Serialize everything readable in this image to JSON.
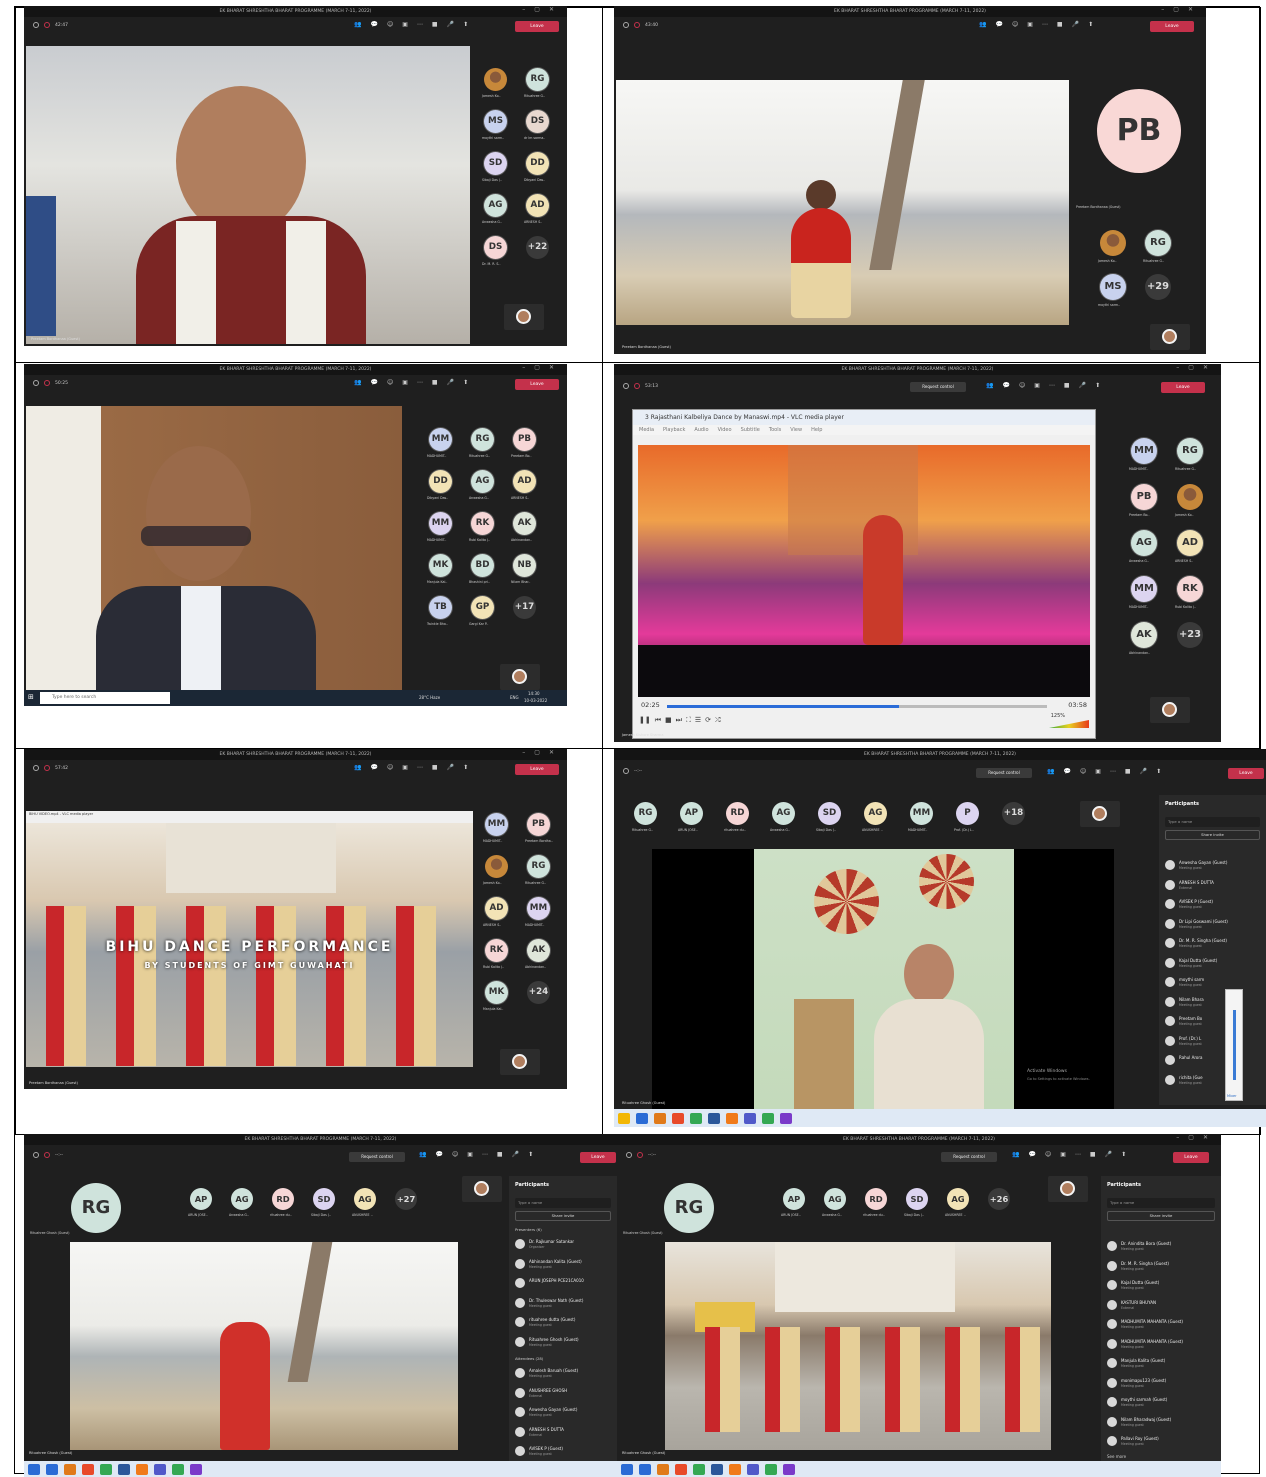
{
  "meeting_title": "EK BHARAT SHRESHTHA BHARAT PROGRAMME (MARCH 7-11, 2022)",
  "common": {
    "leave": "Leave",
    "request_control": "Request control",
    "participants": "Participants",
    "search_placeholder": "Type a name",
    "share_invite": "Share invite"
  },
  "p1": {
    "timer": "42:47",
    "guest": "Preetam Bordhanaa (Guest)",
    "more": "+22",
    "avatars": [
      {
        "initials": "",
        "name": "Jamesh Ko..",
        "color": "#c7883a"
      },
      {
        "initials": "RG",
        "name": "Rituahree G..",
        "color": "#cfe3dc"
      },
      {
        "initials": "MS",
        "name": "moythi sarm..",
        "color": "#c8d2ee"
      },
      {
        "initials": "DS",
        "name": "dr lm sarma..",
        "color": "#e8d8cf"
      },
      {
        "initials": "SD",
        "name": "Sibaji Das (..",
        "color": "#dcd4f0"
      },
      {
        "initials": "DD",
        "name": "Dibyani Das..",
        "color": "#f2e3b6"
      },
      {
        "initials": "AG",
        "name": "Anwesha G..",
        "color": "#cfe3dc"
      },
      {
        "initials": "AD",
        "name": "ARNESH S..",
        "color": "#f2e3b6"
      },
      {
        "initials": "DS",
        "name": "Dr. M. R. S..",
        "color": "#f6d6d6"
      }
    ]
  },
  "p2": {
    "timer": "43:40",
    "big_initials": "PB",
    "big_name": "Preetam Bordhanaa (Guest)",
    "guest": "Preetam Bordhanaa (Guest)",
    "more": "+29",
    "avatars": [
      {
        "initials": "",
        "name": "Jamesh Ko..",
        "color": "#c7883a"
      },
      {
        "initials": "RG",
        "name": "Rituahree G..",
        "color": "#cfe3dc"
      },
      {
        "initials": "MS",
        "name": "moythi sarm..",
        "color": "#c8d2ee"
      }
    ]
  },
  "p3": {
    "timer": "50:25",
    "more": "+17",
    "taskbar_search": "Type here to search",
    "weather": "28°C Haze",
    "clock_time": "14:30",
    "clock_date": "10-03-2022",
    "lang": "ENG",
    "avatars": [
      {
        "initials": "MM",
        "name": "MADHUMIT..",
        "color": "#c8d2ee"
      },
      {
        "initials": "RG",
        "name": "Rituahree G..",
        "color": "#cfe3dc"
      },
      {
        "initials": "PB",
        "name": "Preetam Bo..",
        "color": "#f6d6d6"
      },
      {
        "initials": "DD",
        "name": "Dibyani Das..",
        "color": "#f2e3b6"
      },
      {
        "initials": "AG",
        "name": "Anwesha G..",
        "color": "#cfe3dc"
      },
      {
        "initials": "AD",
        "name": "ARNESH S..",
        "color": "#f2e3b6"
      },
      {
        "initials": "MM",
        "name": "MADHUMIT..",
        "color": "#dcd4f0"
      },
      {
        "initials": "RK",
        "name": "Rubi Kalita (..",
        "color": "#f6d6d6"
      },
      {
        "initials": "AK",
        "name": "Abhinandan..",
        "color": "#dfe6da"
      },
      {
        "initials": "MK",
        "name": "Manjula Kal..",
        "color": "#cfe3dc"
      },
      {
        "initials": "BD",
        "name": "Bhashini pri..",
        "color": "#cfe3dc"
      },
      {
        "initials": "NB",
        "name": "Nilam Bhar..",
        "color": "#dfe6da"
      },
      {
        "initials": "TB",
        "name": "Twinkle Bha..",
        "color": "#c8d2ee"
      },
      {
        "initials": "GP",
        "name": "Gargi Kar P..",
        "color": "#f2e3b6"
      }
    ]
  },
  "p4": {
    "timer": "53:13",
    "more": "+23",
    "vlc_title": "3 Rajasthani Kalbeliya Dance by Manaswi.mp4 - VLC media player",
    "vlc_menu": [
      "Media",
      "Playback",
      "Audio",
      "Video",
      "Subtitle",
      "Tools",
      "View",
      "Help"
    ],
    "time_elapsed": "02:25",
    "time_total": "03:58",
    "volume": "125%",
    "progress": 0.61,
    "guest": "Jamesh Kishore Sharma",
    "avatars": [
      {
        "initials": "MM",
        "name": "MADHUMIT..",
        "color": "#c8d2ee"
      },
      {
        "initials": "RG",
        "name": "Rituahree G..",
        "color": "#cfe3dc"
      },
      {
        "initials": "PB",
        "name": "Preetam Bo..",
        "color": "#f6d6d6"
      },
      {
        "initials": "",
        "name": "Jamesh Ko..",
        "color": "#c7883a"
      },
      {
        "initials": "AG",
        "name": "Anwesha G..",
        "color": "#cfe3dc"
      },
      {
        "initials": "AD",
        "name": "ARNESH S..",
        "color": "#f2e3b6"
      },
      {
        "initials": "MM",
        "name": "MADHUMIT..",
        "color": "#dcd4f0"
      },
      {
        "initials": "RK",
        "name": "Rubi Kalita (..",
        "color": "#f6d6d6"
      },
      {
        "initials": "AK",
        "name": "Abhinandan..",
        "color": "#dfe6da"
      }
    ]
  },
  "p5": {
    "timer": "57:42",
    "more": "+24",
    "guest": "Preetam Bordhanaa (Guest)",
    "overlay_title": "BIHU DANCE PERFORMANCE",
    "overlay_sub": "BY STUDENTS OF GIMT GUWAHATI",
    "vlc_small": "BIHU VIDEO.mp4 - VLC media player",
    "avatars": [
      {
        "initials": "MM",
        "name": "MADHUMIT..",
        "color": "#c8d2ee"
      },
      {
        "initials": "PB",
        "name": "Preetam Bordha..",
        "color": "#f6d6d6"
      },
      {
        "initials": "",
        "name": "Jamesh Ko..",
        "color": "#c7883a"
      },
      {
        "initials": "RG",
        "name": "Rituahree G..",
        "color": "#cfe3dc"
      },
      {
        "initials": "AD",
        "name": "ARNESH S..",
        "color": "#f2e3b6"
      },
      {
        "initials": "MM",
        "name": "MADHUMIT..",
        "color": "#dcd4f0"
      },
      {
        "initials": "RK",
        "name": "Rubi Kalita (..",
        "color": "#f6d6d6"
      },
      {
        "initials": "AK",
        "name": "Abhinandan..",
        "color": "#dfe6da"
      },
      {
        "initials": "MK",
        "name": "Manjula Kal..",
        "color": "#cfe3dc"
      }
    ]
  },
  "p6": {
    "timer": "--:--",
    "more": "+18",
    "guest": "Rituahree Ghosh (Guest)",
    "activate": "Activate Windows",
    "activate_sub": "Go to Settings to activate Windows.",
    "section": "Attendees",
    "avatars": [
      {
        "initials": "RG",
        "name": "Rituahree G..",
        "color": "#cfe3dc"
      },
      {
        "initials": "AP",
        "name": "ARUN JOSE..",
        "color": "#cfe3dc"
      },
      {
        "initials": "RD",
        "name": "rituahree du..",
        "color": "#f6d6d6"
      },
      {
        "initials": "AG",
        "name": "Anwesha G..",
        "color": "#cfe3dc"
      },
      {
        "initials": "SD",
        "name": "Sibaji Das (..",
        "color": "#dcd4f0"
      },
      {
        "initials": "AG",
        "name": "ANUSHREE ..",
        "color": "#f2e3b6"
      },
      {
        "initials": "MM",
        "name": "MADHUMIT..",
        "color": "#cfe3dc"
      },
      {
        "initials": "P",
        "name": "Prof. (Dr.) L..",
        "color": "#dcd4f0"
      }
    ],
    "participants": [
      {
        "name": "Anwesha Gayan (Guest)",
        "sub": "Meeting guest"
      },
      {
        "name": "ARNESH S DUTTA",
        "sub": "External"
      },
      {
        "name": "AVISEK P (Guest)",
        "sub": "Meeting guest"
      },
      {
        "name": "Dr Lipi Goswami (Guest)",
        "sub": "Meeting guest"
      },
      {
        "name": "Dr. M. R. Singha (Guest)",
        "sub": "Meeting guest"
      },
      {
        "name": "Kajal Dutta (Guest)",
        "sub": "Meeting guest"
      },
      {
        "name": "moythi sarm",
        "sub": "Meeting guest"
      },
      {
        "name": "Nilam Bhara",
        "sub": "Meeting guest"
      },
      {
        "name": "Preetam Bo",
        "sub": "Meeting guest"
      },
      {
        "name": "Prof. (Dr.) L",
        "sub": "Meeting guest"
      },
      {
        "name": "Rahul Arora",
        "sub": ""
      },
      {
        "name": "richita (Gue",
        "sub": "Meeting guest"
      }
    ],
    "mixer_label": "Mixer"
  },
  "p7": {
    "timer": "--:--",
    "more": "+27",
    "big_initials": "RG",
    "big_name": "Rituahree Ghosh (Guest)",
    "guest": "Rituahree Ghosh (Guest)",
    "avatars": [
      {
        "initials": "AP",
        "name": "ARUN JOSE..",
        "color": "#cfe3dc"
      },
      {
        "initials": "AG",
        "name": "Anwesha G..",
        "color": "#cfe3dc"
      },
      {
        "initials": "RD",
        "name": "rituahree du..",
        "color": "#f6d6d6"
      },
      {
        "initials": "SD",
        "name": "Sibaji Das (..",
        "color": "#dcd4f0"
      },
      {
        "initials": "AG",
        "name": "ANUSHREE ..",
        "color": "#f2e3b6"
      }
    ],
    "presenters_label": "Presenters (6)",
    "attendees_label": "Attendees (28)",
    "presenters": [
      {
        "name": "Dr. Rajkumar Satankar",
        "sub": "Organiser"
      },
      {
        "name": "Abhinandan Kalita (Guest)",
        "sub": "Meeting guest"
      },
      {
        "name": "ARUN JOSEPH PCE21CA010",
        "sub": ""
      },
      {
        "name": "Dr. Thuleswar Nath (Guest)",
        "sub": "Meeting guest"
      },
      {
        "name": "rituahree dutta (Guest)",
        "sub": "Meeting guest"
      },
      {
        "name": "Rituahree Ghosh (Guest)",
        "sub": "Meeting guest"
      }
    ],
    "attendees": [
      {
        "name": "Amalesh Baruah (Guest)",
        "sub": "Meeting guest"
      },
      {
        "name": "ANUSHREE GHOSH",
        "sub": "External"
      },
      {
        "name": "Anwesha Gayan (Guest)",
        "sub": "Meeting guest"
      },
      {
        "name": "ARNESH S DUTTA",
        "sub": "External"
      },
      {
        "name": "AVISEK P (Guest)",
        "sub": "Meeting guest"
      }
    ]
  },
  "p8": {
    "timer": "--:--",
    "more": "+26",
    "big_initials": "RG",
    "big_name": "Rituahree Ghosh (Guest)",
    "guest": "Rituahree Ghosh (Guest)",
    "see_more": "See more",
    "avatars": [
      {
        "initials": "AP",
        "name": "ARUN JOSE..",
        "color": "#cfe3dc"
      },
      {
        "initials": "AG",
        "name": "Anwesha G..",
        "color": "#cfe3dc"
      },
      {
        "initials": "RD",
        "name": "rituahree du..",
        "color": "#f6d6d6"
      },
      {
        "initials": "SD",
        "name": "Sibaji Das (..",
        "color": "#dcd4f0"
      },
      {
        "initials": "AG",
        "name": "ANUSHREE ..",
        "color": "#f2e3b6"
      }
    ],
    "participants": [
      {
        "name": "Dr. Anindita Bora (Guest)",
        "sub": "Meeting guest"
      },
      {
        "name": "Dr. M. R. Singha (Guest)",
        "sub": "Meeting guest"
      },
      {
        "name": "Kajal Dutta (Guest)",
        "sub": "Meeting guest"
      },
      {
        "name": "KASTURI BHUYAN",
        "sub": "External"
      },
      {
        "name": "MADHUMITA MAHANTA (Guest)",
        "sub": "Meeting guest"
      },
      {
        "name": "MADHUMITA MAHANTA (Guest)",
        "sub": "Meeting guest"
      },
      {
        "name": "Manjula Kalita (Guest)",
        "sub": "Meeting guest"
      },
      {
        "name": "monimapu123 (Guest)",
        "sub": "Meeting guest"
      },
      {
        "name": "moythi sarmah (Guest)",
        "sub": "Meeting guest"
      },
      {
        "name": "Nilam Bharadwaj (Guest)",
        "sub": "Meeting guest"
      },
      {
        "name": "Pallavi Roy (Guest)",
        "sub": "Meeting guest"
      }
    ]
  }
}
